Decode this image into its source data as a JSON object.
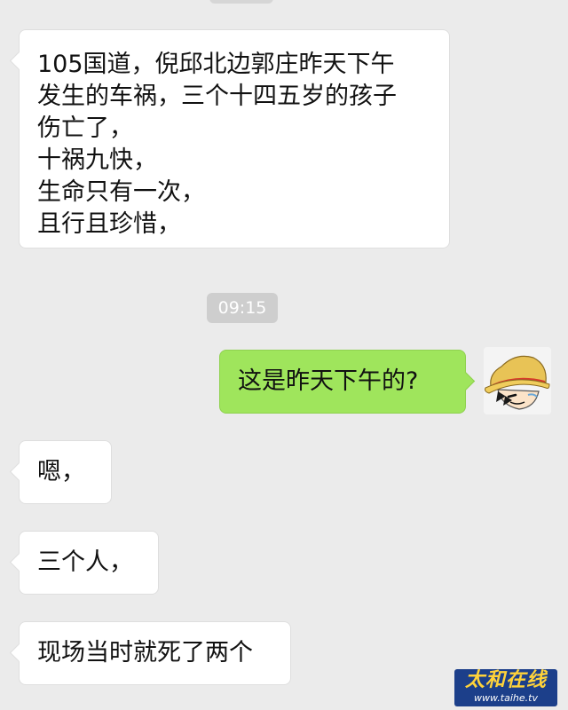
{
  "conversation": {
    "messages": [
      {
        "side": "incoming",
        "lines": [
          "105国道，倪邱北边郭庄昨天下午",
          "发生的车祸，三个十四五岁的孩子",
          "伤亡了，",
          "十祸九快，",
          "生命只有一次，",
          "且行且珍惜，"
        ]
      },
      {
        "side": "outgoing",
        "text": "这是昨天下午的?"
      },
      {
        "side": "incoming",
        "text": "嗯，"
      },
      {
        "side": "incoming",
        "text": "三个人，"
      },
      {
        "side": "incoming",
        "text": "现场当时就死了两个"
      }
    ],
    "timestamp": "09:15",
    "self_avatar_icon": "straw-hat-cartoon-avatar"
  },
  "watermark": {
    "text": "太和在线",
    "url": "www.taihe.tv"
  },
  "colors": {
    "background": "#ebebeb",
    "incoming_bubble": "#ffffff",
    "outgoing_bubble": "#9fe55c",
    "timestamp_pill": "#cecece"
  }
}
